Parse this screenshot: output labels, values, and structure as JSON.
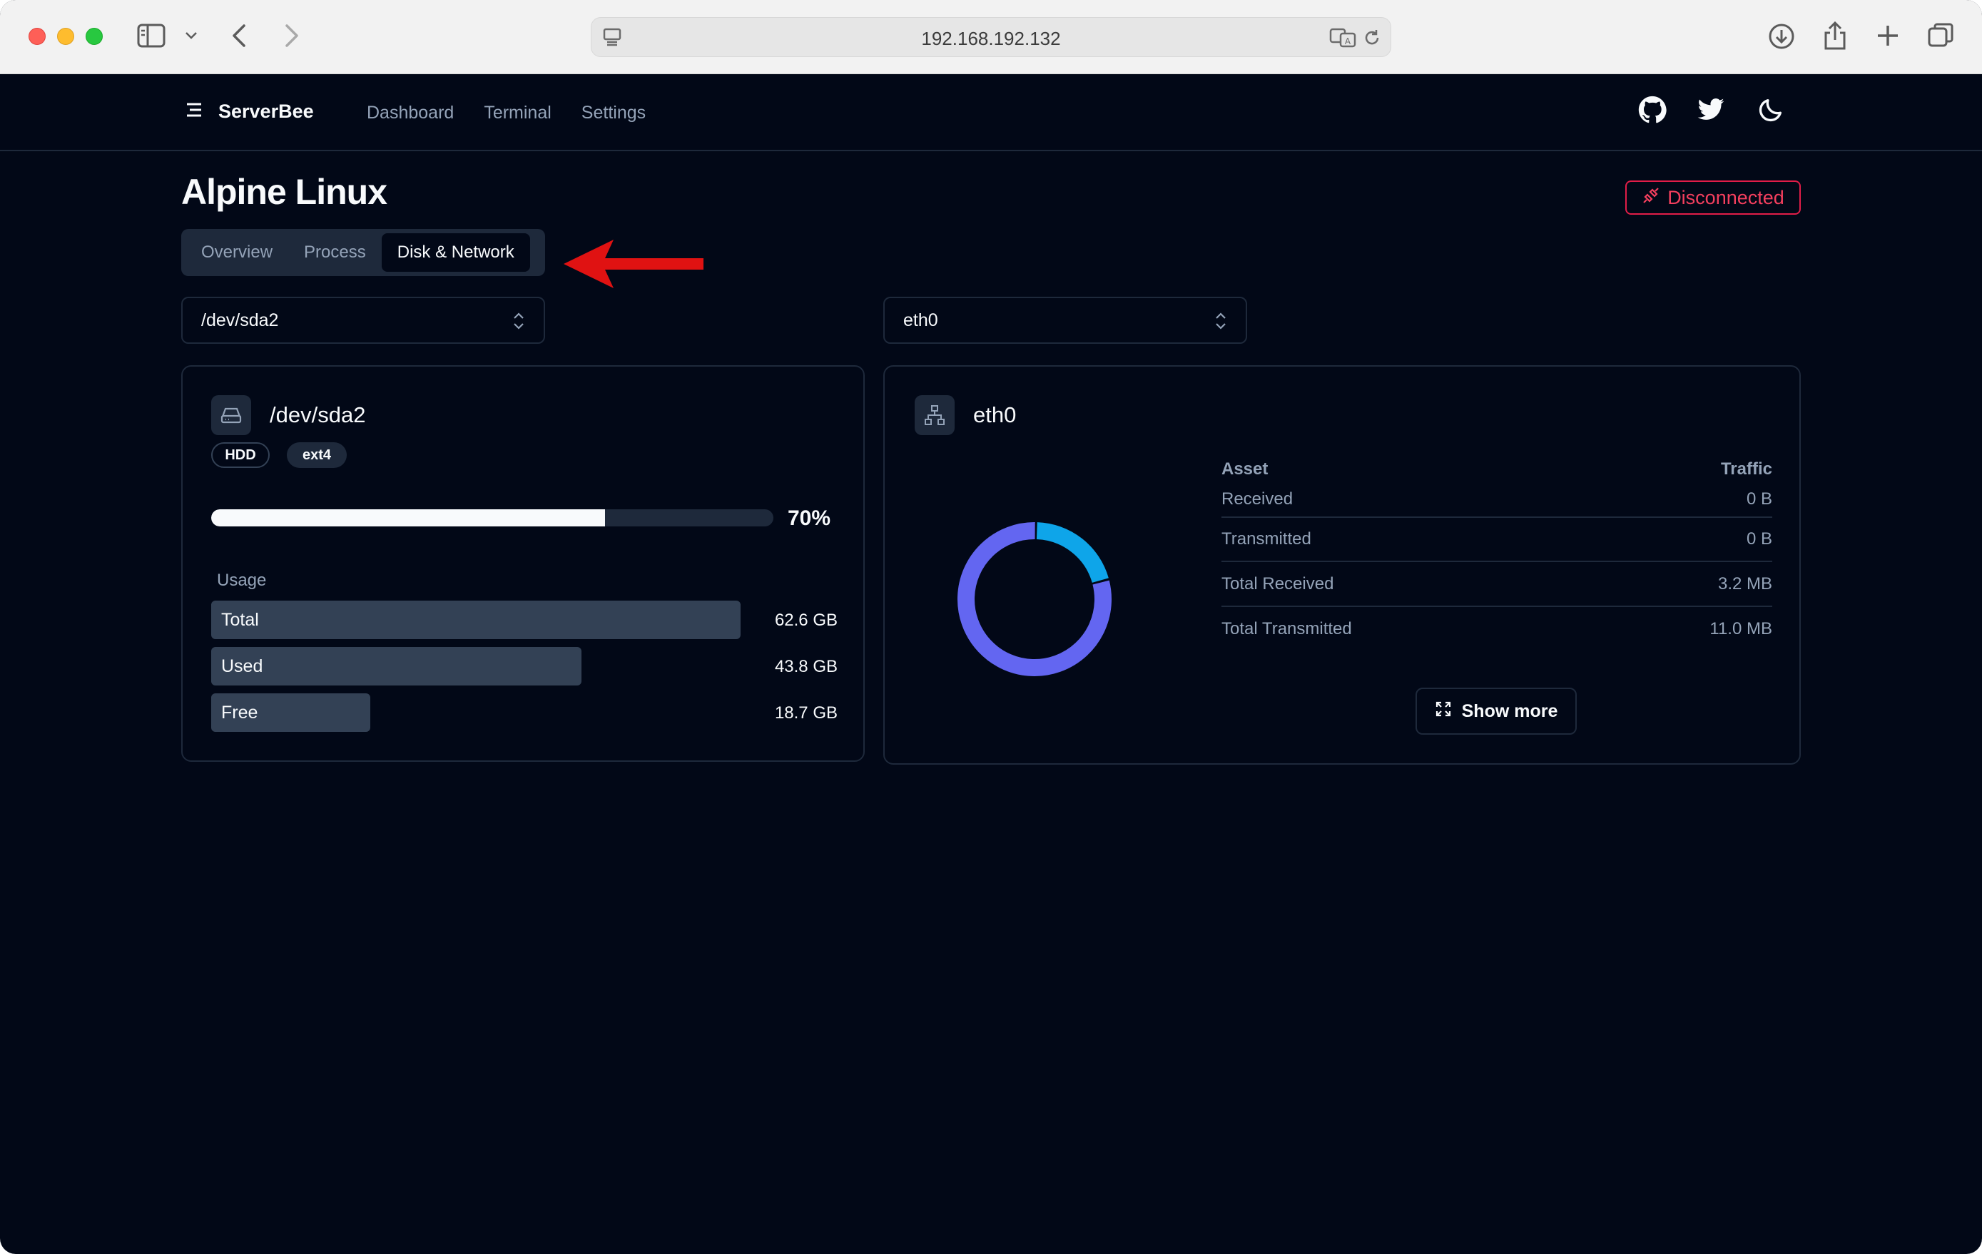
{
  "browser": {
    "url": "192.168.192.132"
  },
  "nav": {
    "brand": "ServerBee",
    "links": [
      "Dashboard",
      "Terminal",
      "Settings"
    ]
  },
  "page": {
    "title": "Alpine Linux",
    "status": "Disconnected",
    "status_color": "#f43f5e",
    "tabs": [
      "Overview",
      "Process",
      "Disk & Network"
    ],
    "active_tab": "Disk & Network"
  },
  "disk": {
    "select_value": "/dev/sda2",
    "name": "/dev/sda2",
    "type_badge": "HDD",
    "fs_badge": "ext4",
    "usage_fraction": 0.7,
    "usage_percent": "70%",
    "usage_label": "Usage",
    "rows": [
      {
        "label": "Total",
        "value": "62.6 GB",
        "fraction": 1.0
      },
      {
        "label": "Used",
        "value": "43.8 GB",
        "fraction": 0.7
      },
      {
        "label": "Free",
        "value": "18.7 GB",
        "fraction": 0.3
      }
    ]
  },
  "network": {
    "select_value": "eth0",
    "name": "eth0",
    "donut": {
      "segments": [
        {
          "fraction": 0.205,
          "color": "#0ea5e9"
        },
        {
          "fraction": 0.795,
          "color": "#6366f1"
        }
      ]
    },
    "table": {
      "col_asset": "Asset",
      "col_traffic": "Traffic",
      "rows": [
        {
          "asset": "Received",
          "traffic": "0 B"
        },
        {
          "asset": "Transmitted",
          "traffic": "0 B"
        },
        {
          "asset": "Total Received",
          "traffic": "3.2 MB"
        },
        {
          "asset": "Total Transmitted",
          "traffic": "11.0 MB"
        }
      ]
    },
    "show_more": "Show more"
  },
  "colors": {
    "background": "#020817",
    "border": "#1e293b",
    "muted_text": "#94a3b8",
    "annotation_arrow": "#e01212"
  }
}
